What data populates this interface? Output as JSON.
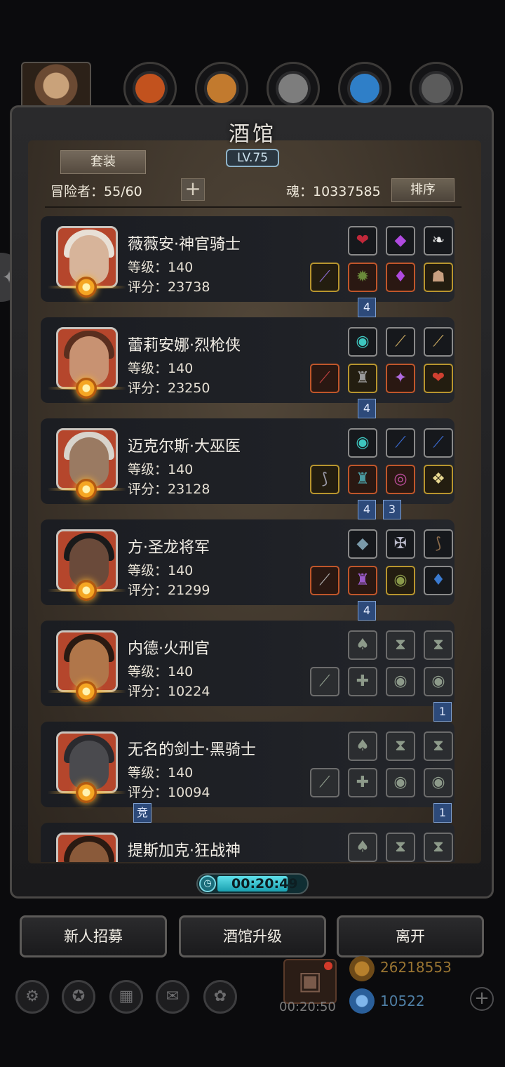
{
  "top_tabs": [
    {
      "icon": "basketball-orb-icon",
      "color": "#c2521e"
    },
    {
      "icon": "wood-plank-orb-icon",
      "color": "#c27a2e"
    },
    {
      "icon": "grey-tiles-orb-icon",
      "color": "#7d7d7d"
    },
    {
      "icon": "blue-feathers-orb-icon",
      "color": "#2f7fc8"
    },
    {
      "icon": "dark-tiles-orb-icon",
      "color": "#5b5b5b"
    }
  ],
  "panel": {
    "title": "酒馆",
    "level": "LV.75",
    "set_button": "套装",
    "adventurer_label": "冒险者：55/60",
    "plus_label": "+",
    "soul_label": "魂：10337585",
    "sort_button": "排序"
  },
  "heroes": [
    {
      "name": "薇薇安·神官骑士",
      "level": "等级：140",
      "score": "评分：23738",
      "portrait_bg": "#b5462c",
      "face": "#d7b49a",
      "hair": "#e8e0d6",
      "top_slots": [
        {
          "glyph": "❤",
          "color": "#c0283a",
          "frame": "dark"
        },
        {
          "glyph": "◆",
          "color": "#b04ae0",
          "frame": "dark"
        },
        {
          "glyph": "❧",
          "color": "#e8e8e8",
          "frame": "dark"
        }
      ],
      "bottom_slots": [
        {
          "glyph": "⟋",
          "color": "#8a6ad0",
          "frame": "gold"
        },
        {
          "glyph": "✹",
          "color": "#6a8a3a",
          "frame": "orange"
        },
        {
          "glyph": "♦",
          "color": "#b04ae0",
          "frame": "orange"
        },
        {
          "glyph": "☗",
          "color": "#c8a080",
          "frame": "gold"
        }
      ],
      "tags": [
        {
          "text": "4",
          "pos": "b"
        }
      ]
    },
    {
      "name": "蕾莉安娜·烈枪侠",
      "level": "等级：140",
      "score": "评分：23250",
      "portrait_bg": "#b5462c",
      "face": "#c89272",
      "hair": "#5a2e1e",
      "top_slots": [
        {
          "glyph": "◉",
          "color": "#3ec7c0",
          "frame": "dark"
        },
        {
          "glyph": "⟋",
          "color": "#c8a860",
          "frame": "dark"
        },
        {
          "glyph": "⟋",
          "color": "#c8a860",
          "frame": "dark"
        }
      ],
      "bottom_slots": [
        {
          "glyph": "⟋",
          "color": "#c04040",
          "frame": "orange"
        },
        {
          "glyph": "♜",
          "color": "#9a9a9a",
          "frame": "gold"
        },
        {
          "glyph": "✦",
          "color": "#b06ae0",
          "frame": "orange"
        },
        {
          "glyph": "❤",
          "color": "#d04030",
          "frame": "gold"
        }
      ],
      "tags": [
        {
          "text": "4",
          "pos": "b"
        }
      ]
    },
    {
      "name": "迈克尔斯·大巫医",
      "level": "等级：140",
      "score": "评分：23128",
      "portrait_bg": "#b5462c",
      "face": "#9a7a62",
      "hair": "#d8d4cc",
      "top_slots": [
        {
          "glyph": "◉",
          "color": "#3ec7c0",
          "frame": "dark"
        },
        {
          "glyph": "⟋",
          "color": "#3a6ad0",
          "frame": "dark"
        },
        {
          "glyph": "⟋",
          "color": "#3a6ad0",
          "frame": "dark"
        }
      ],
      "bottom_slots": [
        {
          "glyph": "⟆",
          "color": "#9a9aa8",
          "frame": "gold"
        },
        {
          "glyph": "♜",
          "color": "#4a9aa0",
          "frame": "orange"
        },
        {
          "glyph": "◎",
          "color": "#c050a0",
          "frame": "orange"
        },
        {
          "glyph": "❖",
          "color": "#e8d890",
          "frame": "gold"
        }
      ],
      "tags": [
        {
          "text": "4",
          "pos": "b"
        },
        {
          "text": "3",
          "pos": "b2"
        }
      ]
    },
    {
      "name": "方·圣龙将军",
      "level": "等级：140",
      "score": "评分：21299",
      "portrait_bg": "#b5462c",
      "face": "#6a4a3a",
      "hair": "#1a1a1a",
      "top_slots": [
        {
          "glyph": "◆",
          "color": "#7a9aaa",
          "frame": "dark"
        },
        {
          "glyph": "✠",
          "color": "#b8b8c8",
          "frame": "dark"
        },
        {
          "glyph": "⟆",
          "color": "#8a6a4a",
          "frame": "dark"
        }
      ],
      "bottom_slots": [
        {
          "glyph": "⟋",
          "color": "#b0b0b0",
          "frame": "orange"
        },
        {
          "glyph": "♜",
          "color": "#9a5ac8",
          "frame": "orange"
        },
        {
          "glyph": "◉",
          "color": "#8a9a4a",
          "frame": "gold"
        },
        {
          "glyph": "♦",
          "color": "#3a7ad0",
          "frame": "dark"
        }
      ],
      "tags": [
        {
          "text": "4",
          "pos": "b"
        }
      ]
    },
    {
      "name": "内德·火刑官",
      "level": "等级：140",
      "score": "评分：10224",
      "portrait_bg": "#b5462c",
      "face": "#b0764a",
      "hair": "#2a1a12",
      "top_slots": [
        {
          "glyph": "♠",
          "color": "#8d9a8a",
          "frame": "grey"
        },
        {
          "glyph": "⧗",
          "color": "#8d9a8a",
          "frame": "grey"
        },
        {
          "glyph": "⧗",
          "color": "#8d9a8a",
          "frame": "grey"
        }
      ],
      "bottom_slots": [
        {
          "glyph": "⟋",
          "color": "#8d9a8a",
          "frame": "grey"
        },
        {
          "glyph": "✚",
          "color": "#8d9a8a",
          "frame": "grey"
        },
        {
          "glyph": "◉",
          "color": "#8d9a8a",
          "frame": "grey"
        },
        {
          "glyph": "◉",
          "color": "#8d9a8a",
          "frame": "grey"
        }
      ],
      "tags": [
        {
          "text": "1",
          "pos": "r"
        }
      ]
    },
    {
      "name": "无名的剑士·黑骑士",
      "level": "等级：140",
      "score": "评分：10094",
      "portrait_bg": "#b5462c",
      "face": "#4a4a4e",
      "hair": "#2a2a2e",
      "top_slots": [
        {
          "glyph": "♠",
          "color": "#8d9a8a",
          "frame": "grey"
        },
        {
          "glyph": "⧗",
          "color": "#8d9a8a",
          "frame": "grey"
        },
        {
          "glyph": "⧗",
          "color": "#8d9a8a",
          "frame": "grey"
        }
      ],
      "bottom_slots": [
        {
          "glyph": "⟋",
          "color": "#8d9a8a",
          "frame": "grey"
        },
        {
          "glyph": "✚",
          "color": "#8d9a8a",
          "frame": "grey"
        },
        {
          "glyph": "◉",
          "color": "#8d9a8a",
          "frame": "grey"
        },
        {
          "glyph": "◉",
          "color": "#8d9a8a",
          "frame": "grey"
        }
      ],
      "tags": [
        {
          "text": "竞",
          "pos": "l"
        },
        {
          "text": "1",
          "pos": "r"
        }
      ]
    },
    {
      "name": "提斯加克·狂战神",
      "level": "等级：",
      "score": "",
      "portrait_bg": "#b5462c",
      "face": "#8a5a3a",
      "hair": "#2a1a12",
      "top_slots": [
        {
          "glyph": "♠",
          "color": "#8d9a8a",
          "frame": "grey"
        },
        {
          "glyph": "⧗",
          "color": "#8d9a8a",
          "frame": "grey"
        },
        {
          "glyph": "⧗",
          "color": "#8d9a8a",
          "frame": "grey"
        }
      ],
      "bottom_slots": [],
      "tags": []
    }
  ],
  "timer": {
    "text": "00:20:49",
    "icon": "clock-icon"
  },
  "buttons": {
    "recruit": "新人招募",
    "upgrade": "酒馆升级",
    "leave": "离开"
  },
  "toolbar": {
    "icons": [
      "gear-icon",
      "compass-icon",
      "tavern-icon",
      "mail-icon",
      "settings-icon"
    ],
    "gift_timer": "00:20:50",
    "gold": "26218553",
    "gems": "10522",
    "add_label": "+"
  }
}
